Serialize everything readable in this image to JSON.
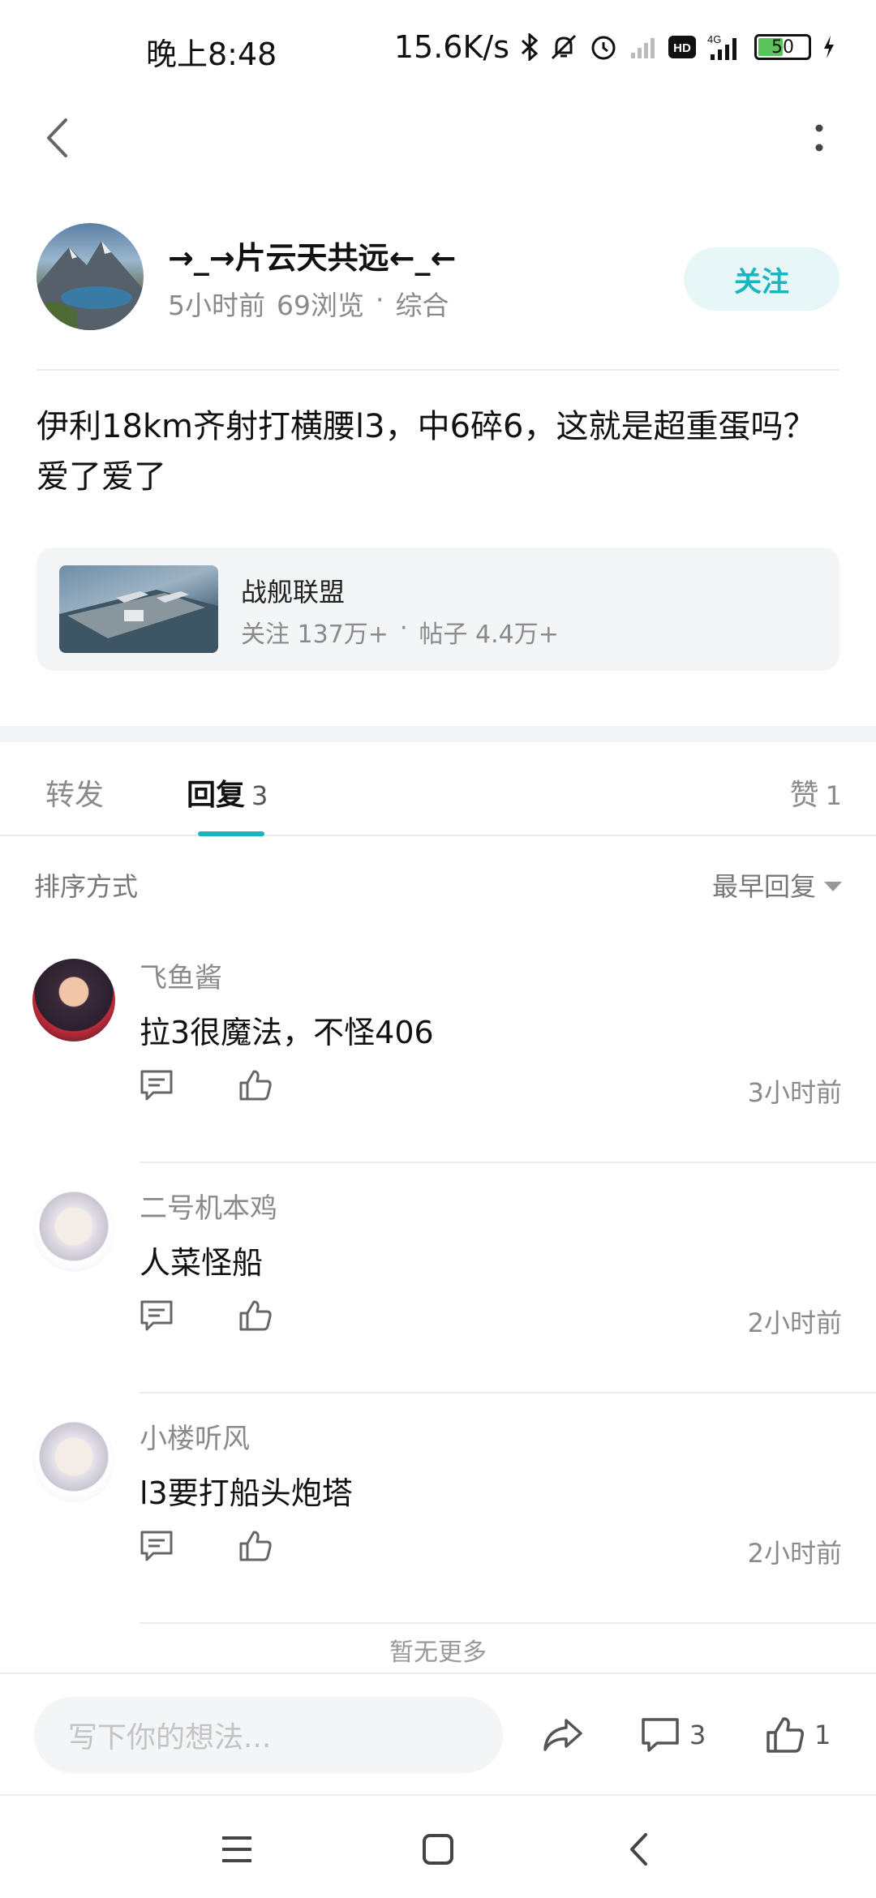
{
  "status_bar": {
    "time": "晚上8:48",
    "net_speed": "15.6K/s",
    "network": "4G",
    "hd_badge": "HD",
    "battery": "50",
    "battery_level": 0.5
  },
  "author": {
    "name": "→_→片云天共远←_←",
    "time_ago": "5小时前",
    "views": "69浏览",
    "dot": "·",
    "category": "综合",
    "follow_label": "关注"
  },
  "post": {
    "text": "伊利18km齐射打横腰l3，中6碎6，这就是超重蛋吗？爱了爱了"
  },
  "forum": {
    "name": "战舰联盟",
    "followers": "关注 137万+",
    "dot": "·",
    "posts": "帖子 4.4万+"
  },
  "tabs": {
    "forward": "转发",
    "reply": "回复",
    "reply_count": "3",
    "like": "赞",
    "like_count": "1"
  },
  "sort": {
    "label": "排序方式",
    "value": "最早回复"
  },
  "replies": [
    {
      "name": "飞鱼酱",
      "text": "拉3很魔法，不怪406",
      "time": "3小时前"
    },
    {
      "name": "二号机本鸡",
      "text": "人菜怪船",
      "time": "2小时前"
    },
    {
      "name": "小楼听风",
      "text": "l3要打船头炮塔",
      "time": "2小时前"
    }
  ],
  "no_more": "暂无更多",
  "bottom_bar": {
    "placeholder": "写下你的想法...",
    "comment_count": "3",
    "like_count": "1"
  },
  "colors": {
    "accent": "#19b5c0",
    "follow_bg": "#e7f7f8",
    "card_bg": "#f4f5f7"
  }
}
